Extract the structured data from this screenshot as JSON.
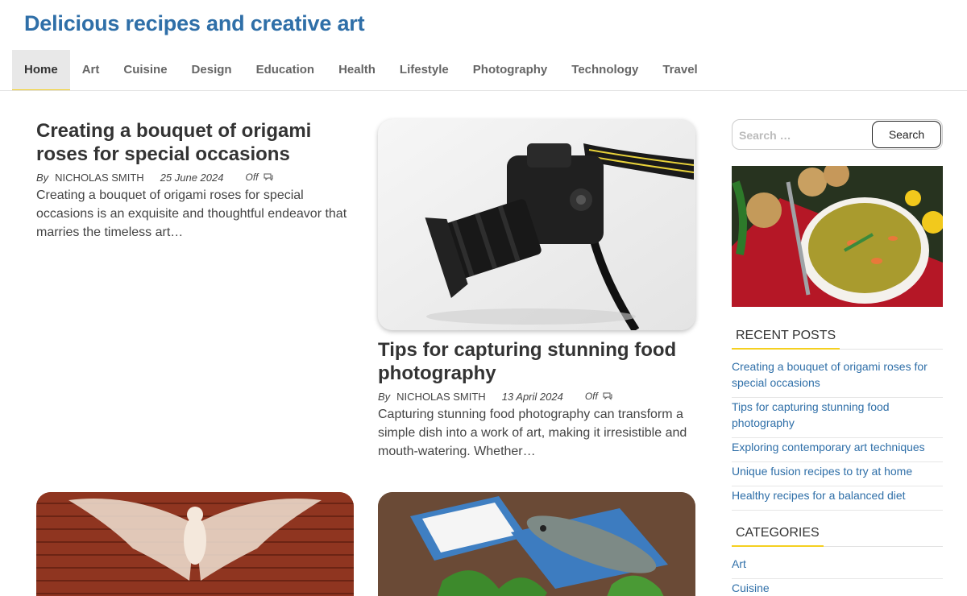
{
  "site": {
    "title": "Delicious recipes and creative art"
  },
  "nav": {
    "items": [
      {
        "label": "Home",
        "active": true
      },
      {
        "label": "Art"
      },
      {
        "label": "Cuisine"
      },
      {
        "label": "Design"
      },
      {
        "label": "Education"
      },
      {
        "label": "Health"
      },
      {
        "label": "Lifestyle"
      },
      {
        "label": "Photography"
      },
      {
        "label": "Technology"
      },
      {
        "label": "Travel"
      }
    ]
  },
  "posts": [
    {
      "title": "Creating a bouquet of origami roses for special occasions",
      "by": "By",
      "author": "NICHOLAS SMITH",
      "date": "25 June 2024",
      "comments": "Off",
      "excerpt": "Creating a bouquet of origami roses for special occasions is an exquisite and thoughtful endeavor that marries the timeless art…"
    },
    {
      "title": "Tips for capturing stunning food photography",
      "by": "By",
      "author": "NICHOLAS SMITH",
      "date": "13 April 2024",
      "comments": "Off",
      "excerpt": "Capturing stunning food photography can transform a simple dish into a work of art, making it irresistible and mouth-watering. Whether…"
    }
  ],
  "search": {
    "placeholder": "Search …",
    "button": "Search"
  },
  "sidebar": {
    "recent_title": "RECENT POSTS",
    "recent_posts": [
      "Creating a bouquet of origami roses for special occasions",
      "Tips for capturing stunning food photography",
      "Exploring contemporary art techniques",
      "Unique fusion recipes to try at home",
      "Healthy recipes for a balanced diet"
    ],
    "categories_title": "CATEGORIES",
    "categories": [
      "Art",
      "Cuisine"
    ]
  },
  "colors": {
    "brand": "#2f6fa8",
    "accent": "#f5d020",
    "link": "#2f6fa8"
  }
}
